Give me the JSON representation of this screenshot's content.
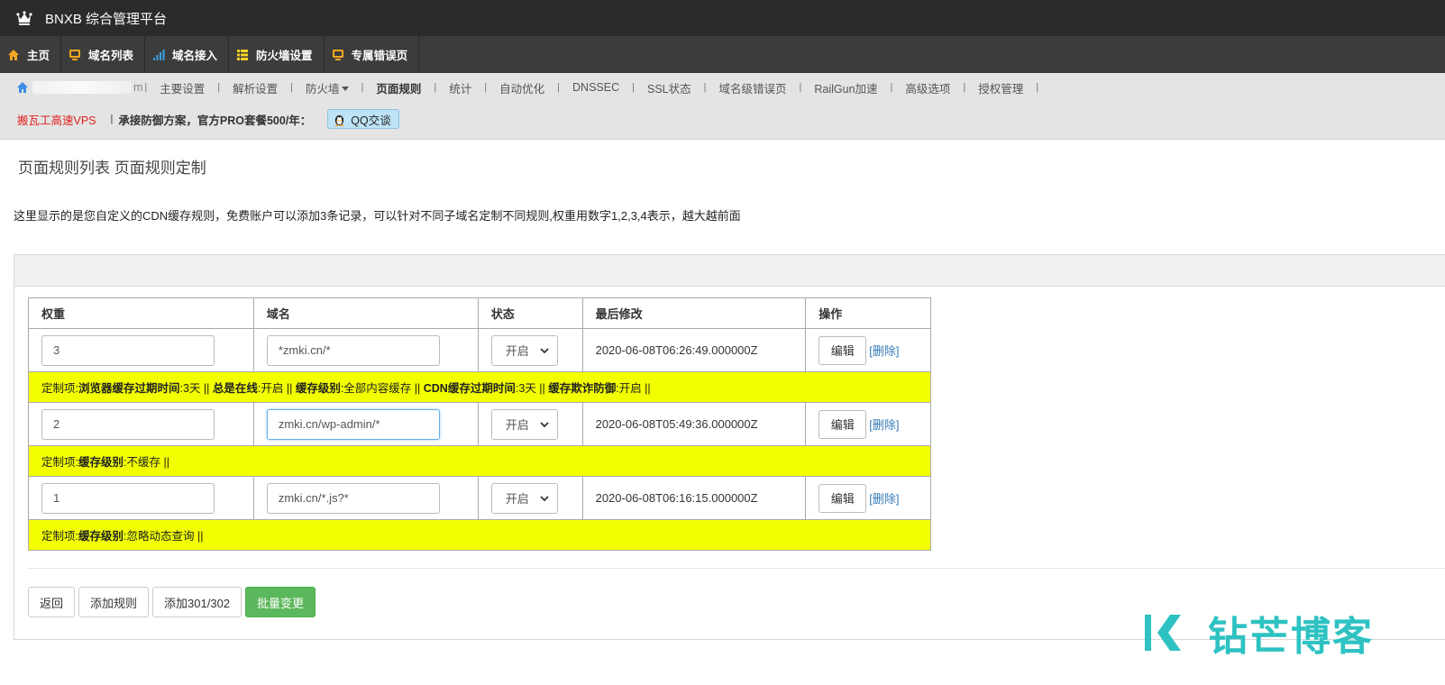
{
  "app": {
    "title": "BNXB 综合管理平台"
  },
  "main_menu": [
    {
      "label": "主页",
      "icon": "home-icon",
      "color": "#f5a623"
    },
    {
      "label": "域名列表",
      "icon": "monitor-icon",
      "color": "#f5a623"
    },
    {
      "label": "域名接入",
      "icon": "signal-icon",
      "color": "#3aa0e8"
    },
    {
      "label": "防火墙设置",
      "icon": "list-icon",
      "color": "#f5d423"
    },
    {
      "label": "专属错误页",
      "icon": "monitor-icon",
      "color": "#f5a623"
    }
  ],
  "subnav": {
    "domain_suffix": "m",
    "items": [
      {
        "label": "主要设置",
        "active": false
      },
      {
        "label": "解析设置",
        "active": false
      },
      {
        "label": "防火墙",
        "active": false,
        "dropdown": true
      },
      {
        "label": "页面规则",
        "active": true
      },
      {
        "label": "统计",
        "active": false
      },
      {
        "label": "自动优化",
        "active": false
      },
      {
        "label": "DNSSEC",
        "active": false
      },
      {
        "label": "SSL状态",
        "active": false
      },
      {
        "label": "域名级错误页",
        "active": false
      },
      {
        "label": "RailGun加速",
        "active": false
      },
      {
        "label": "高级选项",
        "active": false
      },
      {
        "label": "授权管理",
        "active": false
      }
    ],
    "separator": "|",
    "ad_link": "搬瓦工高速VPS",
    "promo_text": "承接防御方案，官方PRO套餐500/年：",
    "qq_button": "QQ交谈"
  },
  "page": {
    "title": "页面规则列表 页面规则定制",
    "description": "这里显示的是您自定义的CDN缓存规则，免费账户可以添加3条记录，可以针对不同子域名定制不同规则,权重用数字1,2,3,4表示，越大越前面"
  },
  "table": {
    "headers": [
      "权重",
      "域名",
      "状态",
      "最后修改",
      "操作"
    ],
    "edit_label": "编辑",
    "delete_label": "[删除]",
    "info_prefix": "定制项:",
    "rows": [
      {
        "weight": "3",
        "domain": "*zmki.cn/*",
        "status": "开启",
        "modified": "2020-06-08T06:26:49.000000Z",
        "info": [
          {
            "k": "浏览器缓存过期时间",
            "v": ":3天 || "
          },
          {
            "k": "总是在线",
            "v": ":开启 || "
          },
          {
            "k": "缓存级别",
            "v": ":全部内容缓存 || "
          },
          {
            "k": "CDN缓存过期时间",
            "v": ":3天 || "
          },
          {
            "k": "缓存欺诈防御",
            "v": ":开启 ||"
          }
        ]
      },
      {
        "weight": "2",
        "domain": "zmki.cn/wp-admin/*",
        "status": "开启",
        "modified": "2020-06-08T05:49:36.000000Z",
        "info": [
          {
            "k": "缓存级别",
            "v": ":不缓存 ||"
          }
        ]
      },
      {
        "weight": "1",
        "domain": "zmki.cn/*.js?*",
        "status": "开启",
        "modified": "2020-06-08T06:16:15.000000Z",
        "info": [
          {
            "k": "缓存级别",
            "v": ":忽略动态查询 ||"
          }
        ]
      }
    ]
  },
  "buttons": {
    "back": "返回",
    "add_rule": "添加规则",
    "add_redirect": "添加301/302",
    "batch_change": "批量变更"
  },
  "watermark": {
    "text": "钻芒博客"
  }
}
